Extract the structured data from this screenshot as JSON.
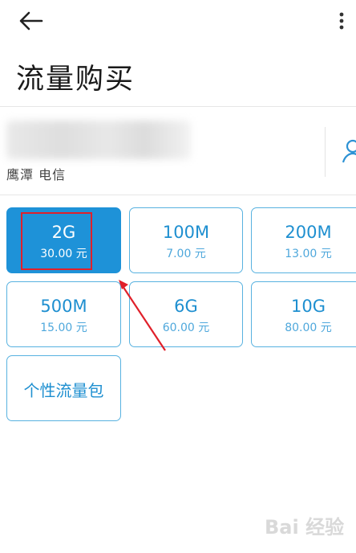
{
  "header": {
    "title": "流量购买",
    "back_icon": "arrow-left-icon",
    "more_icon": "more-vertical-icon"
  },
  "account": {
    "carrier": "鹰潭 电信",
    "contact_icon": "person-icon"
  },
  "packages": [
    {
      "size": "2G",
      "price": "30.00 元",
      "selected": true
    },
    {
      "size": "100M",
      "price": "7.00 元",
      "selected": false
    },
    {
      "size": "200M",
      "price": "13.00 元",
      "selected": false
    },
    {
      "size": "500M",
      "price": "15.00 元",
      "selected": false
    },
    {
      "size": "6G",
      "price": "60.00 元",
      "selected": false
    },
    {
      "size": "10G",
      "price": "80.00 元",
      "selected": false
    }
  ],
  "custom_package": {
    "label": "个性流量包"
  },
  "annotation": {
    "color": "#e0202a"
  },
  "colors": {
    "accent": "#1e92d8",
    "card_border": "#58b2e0",
    "card_text": "#1e8fd0"
  },
  "watermark": {
    "text": "Bai 经验"
  }
}
